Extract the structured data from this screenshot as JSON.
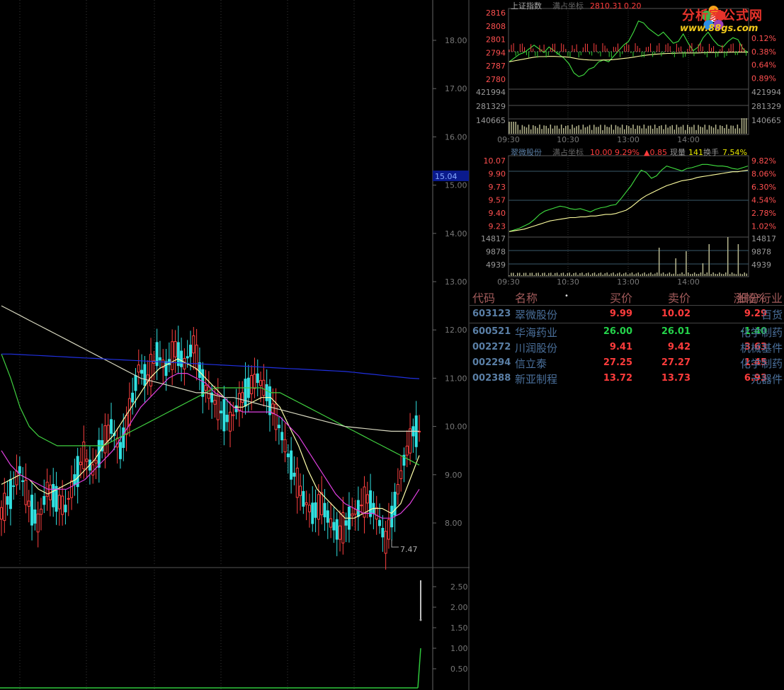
{
  "main_chart": {
    "y_ticks": [
      "18.00",
      "17.00",
      "16.00",
      "15.00",
      "14.00",
      "13.00",
      "12.00",
      "11.00",
      "10.00",
      "9.00",
      "8.00"
    ],
    "current_price": "15.04",
    "low_label": "7.47",
    "indicator_ticks": [
      "2.50",
      "2.00",
      "1.50",
      "1.00",
      "0.50"
    ]
  },
  "index_panel": {
    "title": "上证指数",
    "mode": "满占坐标",
    "price": "2810.31",
    "change": "0.20",
    "left_ticks": [
      "2816",
      "2808",
      "2801",
      "2794",
      "2787",
      "2780"
    ],
    "right_ticks": [
      "0.12%",
      "0.38%",
      "0.64%",
      "0.89%"
    ],
    "vol_ticks": [
      "421994",
      "281329",
      "140665"
    ],
    "time_ticks": [
      "09:30",
      "10:30",
      "13:00",
      "14:00"
    ]
  },
  "stock_panel": {
    "title": "翠微股份",
    "mode": "满占坐标",
    "price": "10.00",
    "change_pct": "9.29%",
    "change": "▲0.85",
    "vol_label": "现量",
    "vol": "141",
    "turnover_label": "换手",
    "turnover": "7.54%",
    "left_ticks": [
      "10.07",
      "9.90",
      "9.73",
      "9.57",
      "9.40",
      "9.23"
    ],
    "right_ticks": [
      "9.82%",
      "8.06%",
      "6.30%",
      "4.54%",
      "2.78%",
      "1.02%"
    ],
    "vol_ticks": [
      "14817",
      "9878",
      "4939"
    ],
    "time_ticks": [
      "09:30",
      "10:30",
      "13:00",
      "14:00"
    ]
  },
  "table": {
    "headers": [
      "代码",
      "名称",
      "买价",
      "卖价",
      "涨幅%",
      "细分行业"
    ],
    "header_bullet": "•",
    "rows": [
      {
        "code": "603123",
        "name": "翠微股份",
        "buy": "9.99",
        "sell": "10.02",
        "chg": "9.29",
        "industry": "百货",
        "chg_color": "red"
      },
      {
        "code": "600521",
        "name": "华海药业",
        "buy": "26.00",
        "sell": "26.01",
        "chg": "-1.40",
        "industry": "化学制药",
        "chg_color": "green"
      },
      {
        "code": "002272",
        "name": "川润股份",
        "buy": "9.41",
        "sell": "9.42",
        "chg": "3.63",
        "industry": "机械基件",
        "chg_color": "red"
      },
      {
        "code": "002294",
        "name": "信立泰",
        "buy": "27.25",
        "sell": "27.27",
        "chg": "1.45",
        "industry": "化学制药",
        "chg_color": "red"
      },
      {
        "code": "002388",
        "name": "新亚制程",
        "buy": "13.72",
        "sell": "13.73",
        "chg": "6.93",
        "industry": "元器件",
        "chg_color": "red"
      }
    ]
  },
  "watermark": {
    "name": "分析家公式网",
    "url": "www.88gs.com"
  },
  "chart_data": [
    {
      "type": "line",
      "title": "",
      "ylim": [
        7.0,
        18.6
      ],
      "grid": true,
      "series": [
        {
          "values": [
            8.2,
            8.6,
            9.1,
            8.4,
            8.0,
            8.7,
            8.5,
            8.3,
            8.9,
            9.4,
            9.1,
            9.6,
            10.0,
            9.5,
            10.3,
            11.2,
            11.0,
            11.5,
            11.2,
            11.6,
            11.3,
            11.7,
            10.9,
            10.6,
            10.3,
            10.1,
            10.5,
            10.8,
            11.0,
            10.7,
            10.2,
            9.6,
            9.0,
            8.5,
            8.2,
            8.4,
            8.0,
            7.8,
            8.1,
            8.3,
            8.5,
            8.2,
            7.6,
            8.4,
            9.3,
            9.9
          ]
        },
        {
          "values": [
            8.8,
            8.9,
            9.0,
            8.9,
            8.7,
            8.6,
            8.7,
            8.8,
            8.9,
            9.1,
            9.3,
            9.6,
            9.8,
            10.1,
            10.4,
            10.7,
            11.0,
            11.2,
            11.3,
            11.4,
            11.3,
            11.2,
            11.0,
            10.8,
            10.6,
            10.4,
            10.4,
            10.5,
            10.6,
            10.6,
            10.4,
            10.0,
            9.6,
            9.1,
            8.7,
            8.5,
            8.3,
            8.1,
            8.1,
            8.2,
            8.3,
            8.3,
            8.2,
            8.4,
            8.9,
            9.4
          ]
        },
        {
          "values": [
            9.5,
            9.2,
            9.0,
            8.9,
            8.8,
            8.7,
            8.7,
            8.7,
            8.8,
            8.9,
            9.1,
            9.3,
            9.5,
            9.8,
            10.1,
            10.4,
            10.6,
            10.8,
            11.0,
            11.1,
            11.1,
            11.0,
            10.9,
            10.7,
            10.6,
            10.4,
            10.3,
            10.3,
            10.3,
            10.3,
            10.2,
            10.0,
            9.8,
            9.5,
            9.2,
            8.9,
            8.6,
            8.4,
            8.3,
            8.2,
            8.2,
            8.1,
            8.1,
            8.2,
            8.4,
            8.7
          ]
        },
        {
          "values": [
            11.5,
            11.0,
            10.4,
            10.0,
            9.8,
            9.7,
            9.6,
            9.6,
            9.6,
            9.6,
            9.6,
            9.6,
            9.7,
            9.8,
            9.9,
            10.0,
            10.1,
            10.2,
            10.3,
            10.4,
            10.5,
            10.6,
            10.7,
            10.8,
            10.8,
            10.8,
            10.8,
            10.8,
            10.8,
            10.7,
            10.7,
            10.6,
            10.5,
            10.4,
            10.3,
            10.2,
            10.1,
            10.0,
            9.9,
            9.8,
            9.7,
            9.6,
            9.5,
            9.4,
            9.3,
            9.2
          ]
        },
        {
          "values": [
            12.5,
            12.4,
            12.3,
            12.2,
            12.1,
            12.0,
            11.9,
            11.8,
            11.7,
            11.6,
            11.5,
            11.4,
            11.3,
            11.2,
            11.1,
            11.0,
            10.95,
            10.9,
            10.85,
            10.8,
            10.75,
            10.7,
            10.7,
            10.65,
            10.6,
            10.6,
            10.55,
            10.5,
            10.45,
            10.4,
            10.35,
            10.3,
            10.25,
            10.2,
            10.15,
            10.1,
            10.05,
            10.0,
            9.98,
            9.96,
            9.94,
            9.92,
            9.9,
            9.9,
            9.9,
            9.9
          ]
        },
        {
          "values": [
            11.5,
            11.5,
            11.49,
            11.48,
            11.47,
            11.46,
            11.45,
            11.44,
            11.43,
            11.42,
            11.41,
            11.4,
            11.39,
            11.38,
            11.37,
            11.36,
            11.35,
            11.34,
            11.33,
            11.32,
            11.31,
            11.3,
            11.29,
            11.28,
            11.27,
            11.26,
            11.25,
            11.24,
            11.23,
            11.22,
            11.21,
            11.2,
            11.19,
            11.18,
            11.17,
            11.16,
            11.15,
            11.14,
            11.12,
            11.1,
            11.08,
            11.06,
            11.04,
            11.02,
            11.0,
            10.99
          ]
        }
      ]
    },
    {
      "type": "line",
      "title": "上证指数",
      "ylim": [
        2776,
        2818
      ],
      "series": [
        {
          "values": [
            2790,
            2792,
            2794,
            2795,
            2797,
            2799,
            2797,
            2795,
            2798,
            2796,
            2794,
            2792,
            2789,
            2784,
            2782,
            2783,
            2786,
            2787,
            2790,
            2791,
            2790,
            2793,
            2796,
            2799,
            2801,
            2806,
            2812,
            2811,
            2808,
            2806,
            2804,
            2806,
            2803,
            2800,
            2801,
            2805,
            2800,
            2796,
            2798,
            2803,
            2806,
            2802,
            2799,
            2798,
            2801,
            2803,
            2802,
            2797,
            2795
          ]
        },
        {
          "values": [
            2790,
            2790.5,
            2791,
            2791.5,
            2792,
            2792.5,
            2792.8,
            2792.8,
            2792.9,
            2792.9,
            2792.8,
            2792.7,
            2792.5,
            2792,
            2791.5,
            2791.2,
            2791,
            2790.9,
            2790.9,
            2791,
            2791,
            2791.2,
            2791.5,
            2791.8,
            2792.1,
            2792.5,
            2793,
            2793.4,
            2793.7,
            2794,
            2794.2,
            2794.4,
            2794.5,
            2794.6,
            2794.7,
            2794.8,
            2794.8,
            2794.8,
            2794.8,
            2794.9,
            2795,
            2795,
            2795,
            2795.1,
            2795.1,
            2795.2,
            2795.2,
            2795.2,
            2795.2
          ]
        }
      ]
    },
    {
      "type": "line",
      "title": "翠微股份",
      "ylim": [
        9.15,
        10.1
      ],
      "series": [
        {
          "values": [
            9.2,
            9.22,
            9.24,
            9.27,
            9.3,
            9.35,
            9.41,
            9.45,
            9.47,
            9.49,
            9.51,
            9.5,
            9.48,
            9.47,
            9.48,
            9.46,
            9.44,
            9.47,
            9.49,
            9.5,
            9.52,
            9.53,
            9.6,
            9.68,
            9.76,
            9.86,
            9.95,
            9.92,
            9.85,
            9.88,
            9.95,
            10.0,
            9.98,
            9.96,
            9.94,
            9.97,
            9.98,
            10.0,
            10.02,
            10.02,
            10.01,
            10.0,
            10.0,
            9.99,
            9.97,
            9.96,
            9.98,
            10.0
          ]
        },
        {
          "values": [
            9.2,
            9.21,
            9.22,
            9.23,
            9.25,
            9.27,
            9.29,
            9.31,
            9.33,
            9.34,
            9.35,
            9.36,
            9.37,
            9.37,
            9.38,
            9.38,
            9.39,
            9.39,
            9.4,
            9.41,
            9.41,
            9.42,
            9.44,
            9.46,
            9.5,
            9.55,
            9.6,
            9.64,
            9.67,
            9.7,
            9.73,
            9.76,
            9.78,
            9.8,
            9.82,
            9.83,
            9.84,
            9.86,
            9.87,
            9.88,
            9.89,
            9.9,
            9.91,
            9.92,
            9.93,
            9.93,
            9.94,
            9.95
          ]
        }
      ]
    }
  ]
}
